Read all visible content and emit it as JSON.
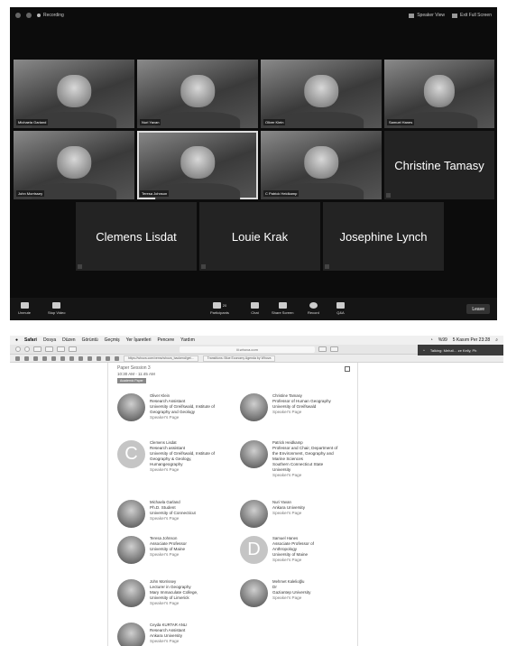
{
  "zoom": {
    "top_left": "Recording",
    "speaker_view": "Speaker View",
    "exit_full": "Exit Full Screen",
    "tiles": [
      {
        "name": "Michaela Garland"
      },
      {
        "name": "Nuri Yavan"
      },
      {
        "name": "Oliver Klein"
      },
      {
        "name": "Samuel Hanes"
      },
      {
        "name": "John Morrissey"
      },
      {
        "name": "Teresa Johnson"
      },
      {
        "name": "C Patrick Heidkamp"
      }
    ],
    "big_tiles": [
      "Christine Tamasy",
      "Clemens Lisdat",
      "Louie Krak",
      "Josephine Lynch"
    ],
    "bar": {
      "unmute": "Unmute",
      "stop_video": "Stop Video",
      "participants": "Participants",
      "participants_count": "20",
      "chat": "Chat",
      "share": "Share Screen",
      "record": "Record",
      "qa": "Q&A",
      "leave": "Leave"
    }
  },
  "safari": {
    "menu": [
      "Safari",
      "Dosya",
      "Düzen",
      "Görüntü",
      "Geçmiş",
      "Yer İşaretleri",
      "Pencere",
      "Yardım"
    ],
    "clock": "5 Kasım Per 23:28",
    "battery": "%99",
    "url": "iii.whova.com",
    "notification": "Talking: Mehzil... ze Kelly, Ph",
    "bm_url": "https://whova.com/xems/whova_backend/get...",
    "bm_tab": "Transitions: Blue Economy Agenda by Whova"
  },
  "session": {
    "title": "Paper Session 3",
    "time": "10:30 AM - 11:45 AM",
    "tag": "Academic Paper"
  },
  "speakers": [
    {
      "name": "Oliver Klein",
      "lines": [
        "Research Assistant",
        "University of Greifswald, Institute of",
        "Geography and Geology"
      ],
      "link": "Speaker's Page",
      "avatar": ""
    },
    {
      "name": "Christine Tamasy",
      "lines": [
        "Professor of Human Geography",
        "University of Greifswald"
      ],
      "link": "Speaker's Page",
      "avatar": ""
    },
    {
      "name": "Clemens Lisdat",
      "lines": [
        "Research assistant",
        "University of Greifswald, Institute of",
        "Geography & Geology,",
        "Humangeography"
      ],
      "link": "Speaker's Page",
      "avatar": "C"
    },
    {
      "name": "Patrick Heidkamp",
      "lines": [
        "Professor and Chair, Department of",
        "the Environment, Geography and",
        "Marine Sciences",
        "Southern Connecticut State",
        "University"
      ],
      "link": "Speaker's Page",
      "avatar": ""
    },
    {
      "name": "Michaela Garland",
      "lines": [
        "Ph.D. Student",
        "University of Connecticut"
      ],
      "link": "Speaker's Page",
      "avatar": ""
    },
    {
      "name": "Nuri Yavan",
      "lines": [
        "Ankara University"
      ],
      "link": "Speaker's Page",
      "avatar": ""
    },
    {
      "name": "Teresa Johnson",
      "lines": [
        "Associate Professor",
        "University of Maine"
      ],
      "link": "Speaker's Page",
      "avatar": ""
    },
    {
      "name": "Samuel Hanes",
      "lines": [
        "Associate Professor of",
        "Anthropology",
        "University of Maine"
      ],
      "link": "Speaker's Page",
      "avatar": "D"
    },
    {
      "name": "John Morrissey",
      "lines": [
        "Lecturer in Geography",
        "Mary Immaculate College,",
        "University of Limerick"
      ],
      "link": "Speaker's Page",
      "avatar": ""
    },
    {
      "name": "Mehmet Kalelioğlu",
      "lines": [
        "Dr",
        "Gaziantep University"
      ],
      "link": "Speaker's Page",
      "avatar": ""
    },
    {
      "name": "Ceyda KURTAR ANLI",
      "lines": [
        "Research Assistant",
        "Ankara University"
      ],
      "link": "Speaker's Page",
      "avatar": ""
    }
  ]
}
